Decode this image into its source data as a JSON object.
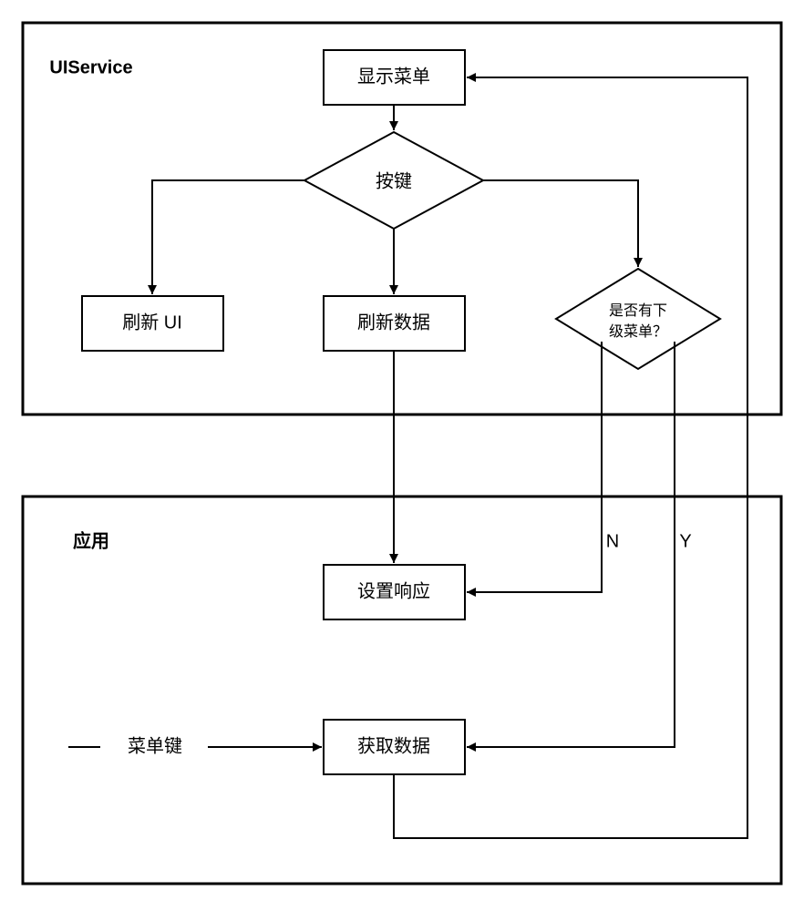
{
  "containers": {
    "uiservice_title": "UIService",
    "application_title": "应用"
  },
  "nodes": {
    "display_menu": "显示菜单",
    "keypress": "按键",
    "refresh_ui": "刷新 UI",
    "refresh_data": "刷新数据",
    "has_submenu_line1": "是否有下",
    "has_submenu_line2": "级菜单？",
    "set_response": "设置响应",
    "get_data": "获取数据",
    "menu_key": "菜单键"
  },
  "edges": {
    "no": "N",
    "yes": "Y"
  }
}
